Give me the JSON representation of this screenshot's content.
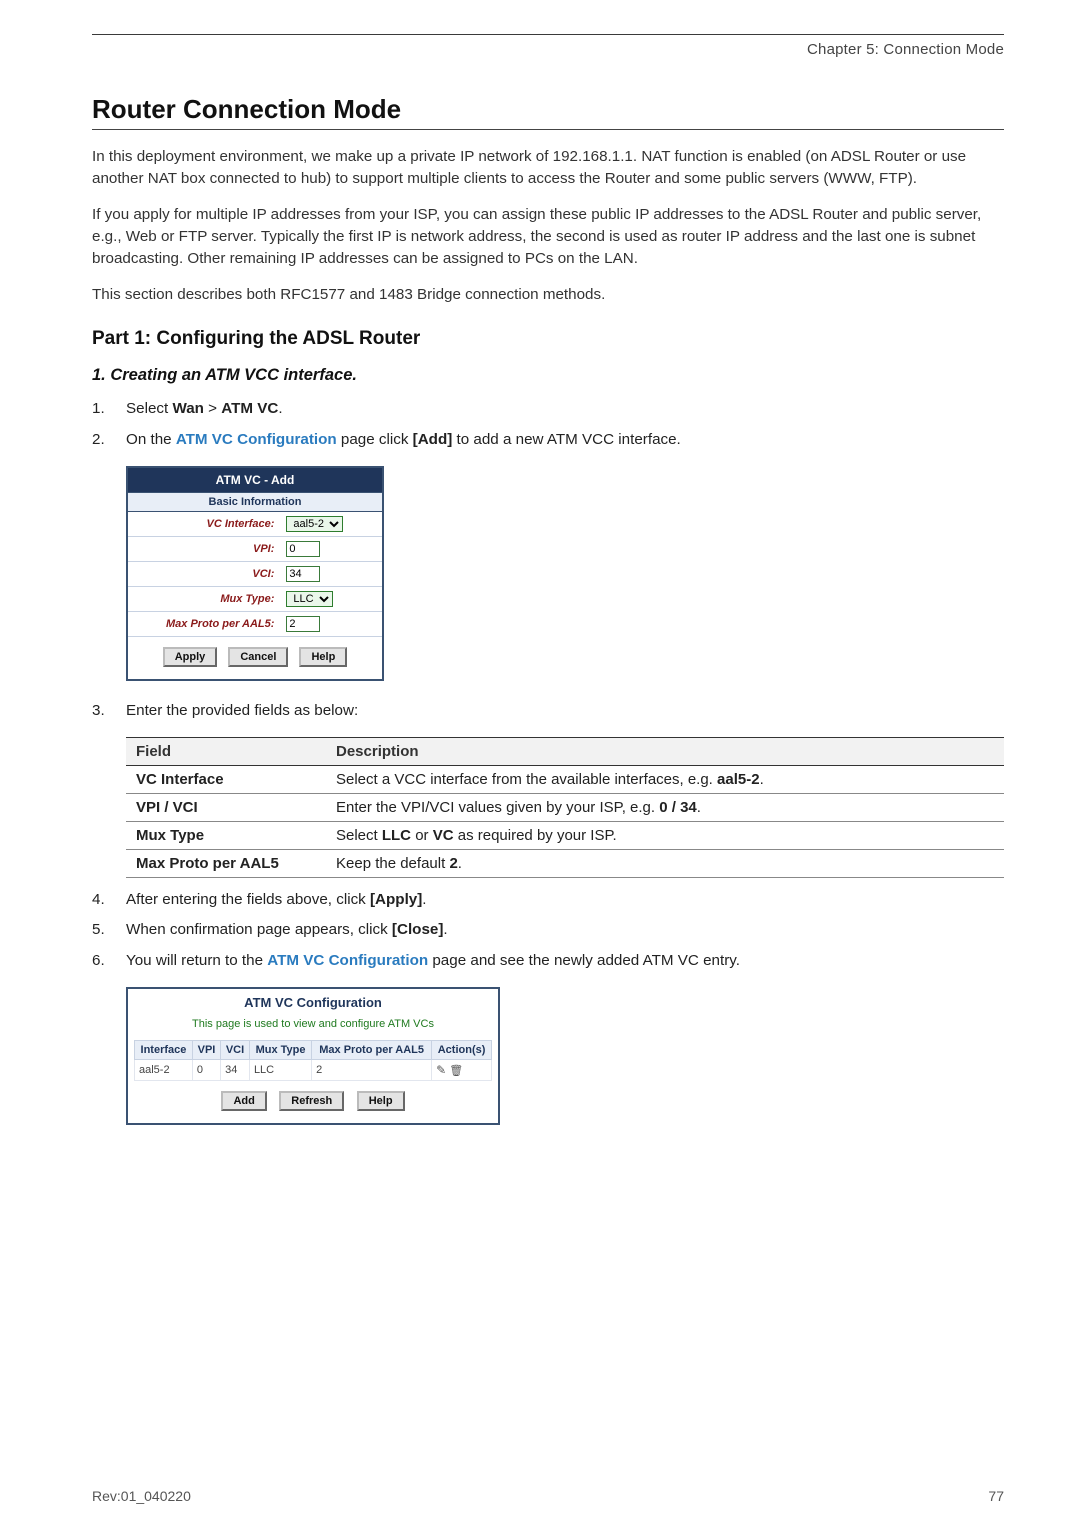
{
  "header": {
    "chapter": "Chapter 5: Connection Mode"
  },
  "h1": "Router Connection Mode",
  "intro": {
    "p1": "In this deployment environment, we make up a private IP network of 192.168.1.1. NAT function is enabled (on ADSL Router or use another NAT box connected to hub) to support multiple clients to access the Router and some public servers (WWW, FTP).",
    "p2": "If you apply for multiple IP addresses from your ISP, you can assign these public IP addresses to the ADSL Router and public server, e.g., Web or FTP server. Typically the first IP is network address, the second is used as router IP address and the last one is subnet broadcasting. Other remaining IP addresses can be assigned to PCs on the LAN.",
    "p3": "This section describes both RFC1577 and 1483 Bridge connection methods."
  },
  "part1": {
    "heading": "Part 1: Configuring the ADSL Router",
    "sub1": "1. Creating an ATM VCC interface.",
    "step1_pre": "Select ",
    "step1_wan": "Wan",
    "step1_gt": " > ",
    "step1_atm": "ATM VC",
    "step1_post": ".",
    "step2_pre": "On the ",
    "step2_link": "ATM VC Configuration",
    "step2_mid": " page click ",
    "step2_add": "[Add]",
    "step2_post": " to add a new ATM VCC interface."
  },
  "atm_add": {
    "title": "ATM VC - Add",
    "basic": "Basic Information",
    "rows": {
      "vc_interface_k": "VC Interface:",
      "vc_interface_v": "aal5-2",
      "vpi_k": "VPI:",
      "vpi_v": "0",
      "vci_k": "VCI:",
      "vci_v": "34",
      "mux_k": "Mux Type:",
      "mux_v": "LLC",
      "max_k": "Max Proto per AAL5:",
      "max_v": "2"
    },
    "buttons": {
      "apply": "Apply",
      "cancel": "Cancel",
      "help": "Help"
    }
  },
  "step3_intro": "Enter the provided fields as below:",
  "fd": {
    "h_field": "Field",
    "h_desc": "Description",
    "rows": [
      {
        "f": "VC Interface",
        "d_pre": "Select a VCC interface from the available interfaces, e.g. ",
        "d_bold": "aal5-2",
        "d_post": "."
      },
      {
        "f": "VPI / VCI",
        "d_pre": "Enter the VPI/VCI values given by your ISP, e.g. ",
        "d_bold": "0 / 34",
        "d_post": "."
      },
      {
        "f": "Mux Type",
        "d_pre": "Select ",
        "d_bold": "LLC",
        "d_mid": " or ",
        "d_bold2": "VC",
        "d_post": " as required by your ISP."
      },
      {
        "f": "Max Proto per AAL5",
        "d_pre": "Keep the default ",
        "d_bold": "2",
        "d_post": "."
      }
    ]
  },
  "step4_pre": "After entering the fields above, click ",
  "step4_bold": "[Apply]",
  "step4_post": ".",
  "step5_pre": "When confirmation page appears, click ",
  "step5_bold": "[Close]",
  "step5_post": ".",
  "step6_pre": "You will return to the ",
  "step6_link": "ATM VC Configuration",
  "step6_post": " page and see the newly added ATM VC entry.",
  "atm_conf": {
    "title": "ATM VC Configuration",
    "desc": "This page is used to view and configure ATM VCs",
    "headers": [
      "Interface",
      "VPI",
      "VCI",
      "Mux Type",
      "Max Proto per AAL5",
      "Action(s)"
    ],
    "row": {
      "iface": "aal5-2",
      "vpi": "0",
      "vci": "34",
      "mux": "LLC",
      "max": "2"
    },
    "buttons": {
      "add": "Add",
      "refresh": "Refresh",
      "help": "Help"
    }
  },
  "footer": {
    "rev": "Rev:01_040220",
    "page": "77"
  }
}
